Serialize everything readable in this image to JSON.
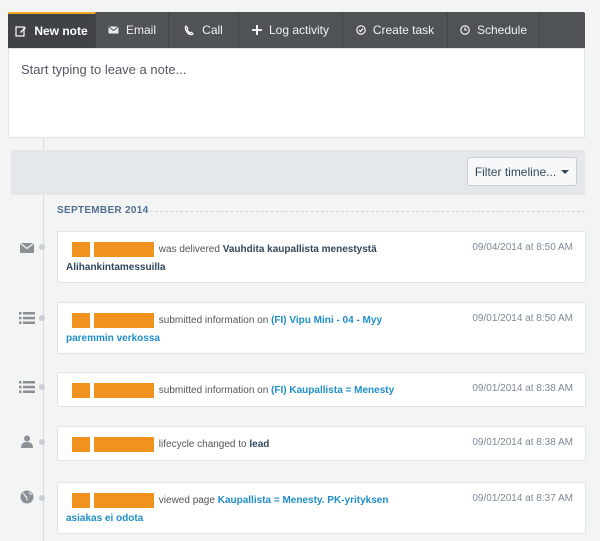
{
  "tabs": [
    {
      "label": "New note",
      "icon": "edit-icon"
    },
    {
      "label": "Email",
      "icon": "envelope-icon"
    },
    {
      "label": "Call",
      "icon": "phone-icon"
    },
    {
      "label": "Log activity",
      "icon": "plus-icon"
    },
    {
      "label": "Create task",
      "icon": "check-circle-icon"
    },
    {
      "label": "Schedule",
      "icon": "clock-icon"
    }
  ],
  "composer": {
    "placeholder": "Start typing to leave a note..."
  },
  "filter": {
    "label": "Filter timeline..."
  },
  "timeline": {
    "month": "SEPTEMBER 2014",
    "events": [
      {
        "icon": "envelope-icon",
        "action": "was delivered",
        "target": "Vauhdita kaupallista menestystä",
        "target2": "Alihankintamessuilla",
        "timestamp": "09/04/2014 at 8:50 AM"
      },
      {
        "icon": "form-list-icon",
        "action": "submitted information on",
        "target": "(FI) Vipu Mini - 04 - Myy",
        "target2": "paremmin verkossa",
        "timestamp": "09/01/2014 at 8:50 AM"
      },
      {
        "icon": "form-list-icon",
        "action": "submitted information on",
        "target": "(FI) Kaupallista = Menesty",
        "timestamp": "09/01/2014 at 8:38 AM"
      },
      {
        "icon": "person-icon",
        "action": "lifecycle changed to",
        "target": "lead",
        "timestamp": "09/01/2014 at 8:38 AM"
      },
      {
        "icon": "globe-icon",
        "action": "viewed page",
        "target": "Kaupallista = Menesty. PK-yrityksen",
        "target2": "asiakas ei odota",
        "timestamp": "09/01/2014 at 8:37 AM"
      }
    ]
  },
  "colors": {
    "accent": "#f5a623",
    "redaction": "#f0921f",
    "link": "#1f8ec9"
  }
}
